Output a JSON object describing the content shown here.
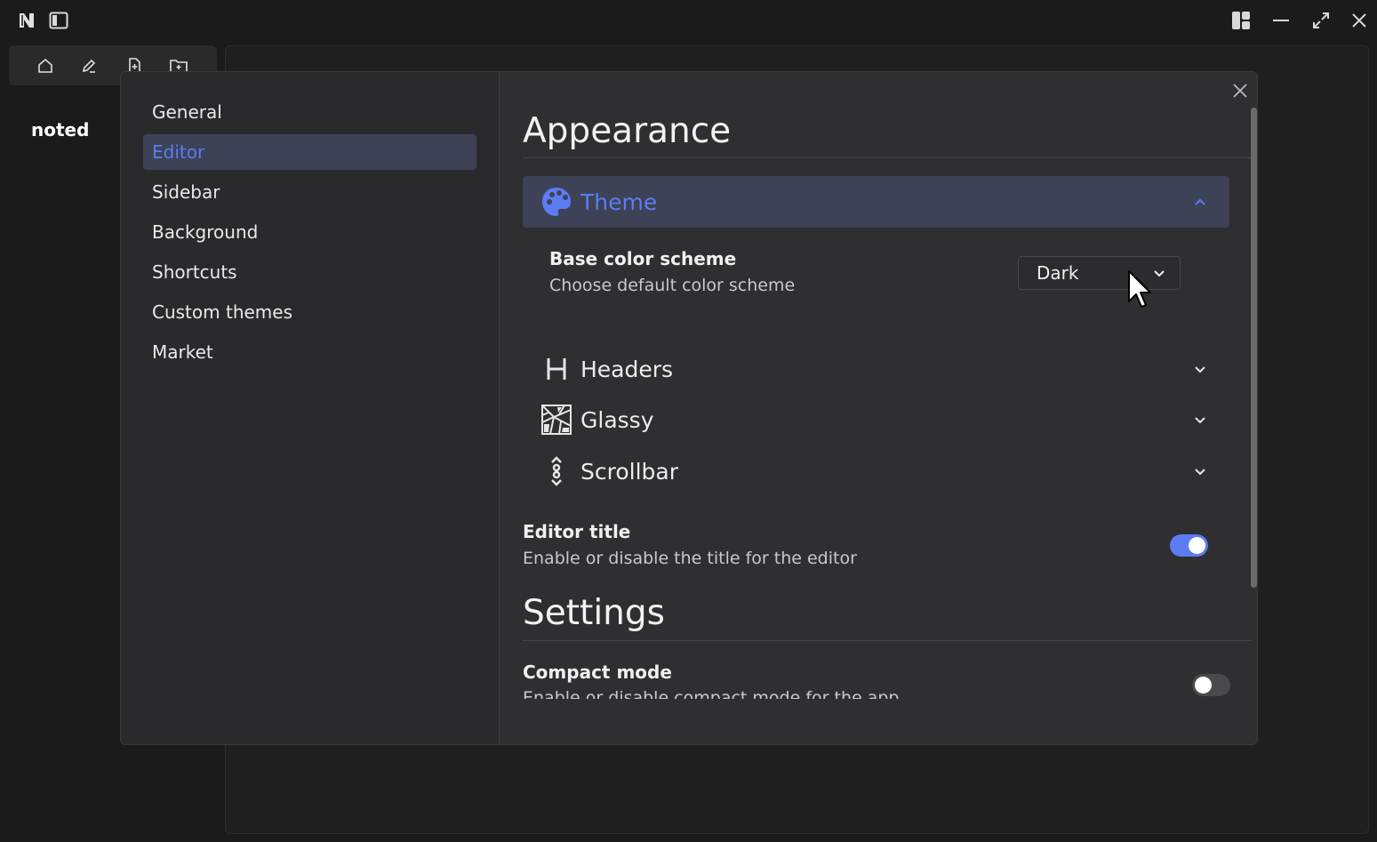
{
  "app": {
    "brand": "noted"
  },
  "settings": {
    "nav": [
      {
        "label": "General",
        "active": false
      },
      {
        "label": "Editor",
        "active": true
      },
      {
        "label": "Sidebar",
        "active": false
      },
      {
        "label": "Background",
        "active": false
      },
      {
        "label": "Shortcuts",
        "active": false
      },
      {
        "label": "Custom themes",
        "active": false
      },
      {
        "label": "Market",
        "active": false
      }
    ],
    "appearance": {
      "title": "Appearance",
      "theme": {
        "label": "Theme",
        "icon": "palette-icon",
        "expanded": true,
        "base_color_scheme": {
          "title": "Base color scheme",
          "description": "Choose default color scheme",
          "value": "Dark"
        }
      },
      "headers": {
        "label": "Headers",
        "icon": "heading-icon"
      },
      "glassy": {
        "label": "Glassy",
        "icon": "glass-icon"
      },
      "scrollbar": {
        "label": "Scrollbar",
        "icon": "scrollbar-icon"
      },
      "editor_title": {
        "title": "Editor title",
        "description": "Enable or disable the title for the editor",
        "enabled": true
      }
    },
    "settings_section": {
      "title": "Settings",
      "compact_mode": {
        "title": "Compact mode",
        "description": "Enable or disable compact mode for the app",
        "enabled": false
      }
    }
  },
  "colors": {
    "accent": "#5c7cf3",
    "active_bg": "#3d4256",
    "modal_bg": "#2f2f31",
    "page_bg": "#1b1b1c"
  }
}
